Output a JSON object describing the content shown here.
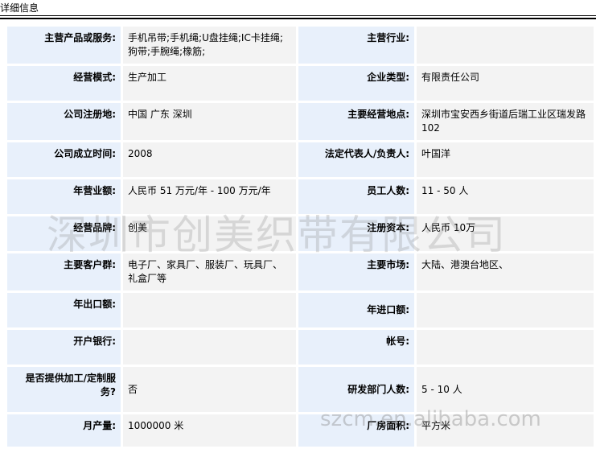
{
  "header": {
    "title": "详细信息"
  },
  "rows": [
    {
      "left_label": "主营产品或服务:",
      "left_value": "手机吊带;手机绳;U盘挂绳;IC卡挂绳;狗带;手腕绳;橡筋;",
      "right_label": "主营行业:",
      "right_value": ""
    },
    {
      "left_label": "经营模式:",
      "left_value": "生产加工",
      "right_label": "企业类型:",
      "right_value": "有限责任公司"
    },
    {
      "left_label": "公司注册地:",
      "left_value": "中国 广东 深圳",
      "right_label": "主要经营地点:",
      "right_value": "深圳市宝安西乡街道后瑞工业区瑞发路102"
    },
    {
      "left_label": "公司成立时间:",
      "left_value": "2008",
      "right_label": "法定代表人/负责人:",
      "right_value": "叶国洋"
    },
    {
      "left_label": "年营业额:",
      "left_value": "人民币 51 万元/年 - 100 万元/年",
      "right_label": "员工人数:",
      "right_value": "11 - 50 人"
    },
    {
      "left_label": "经营品牌:",
      "left_value": "创美",
      "right_label": "注册资本:",
      "right_value": "人民币 10万"
    },
    {
      "left_label": "主要客户群:",
      "left_value": "电子厂、家具厂、服装厂、玩具厂、礼盒厂等",
      "right_label": "主要市场:",
      "right_value": "大陆、港澳台地区、"
    },
    {
      "left_label": "年出口额:",
      "left_value": "",
      "right_label": "年进口额:",
      "right_value": ""
    },
    {
      "left_label": "开户银行:",
      "left_value": "",
      "right_label": "帐号:",
      "right_value": ""
    },
    {
      "left_label": "是否提供加工/定制服务?",
      "left_value": "否",
      "right_label": "研发部门人数:",
      "right_value": "5 - 10 人"
    },
    {
      "left_label": "月产量:",
      "left_value": "1000000 米",
      "right_label": "厂房面积:",
      "right_value": "平方米"
    }
  ],
  "watermarks": {
    "company": "深圳市创美织带有限公司",
    "site": "szcm.en.alibaba.com"
  }
}
